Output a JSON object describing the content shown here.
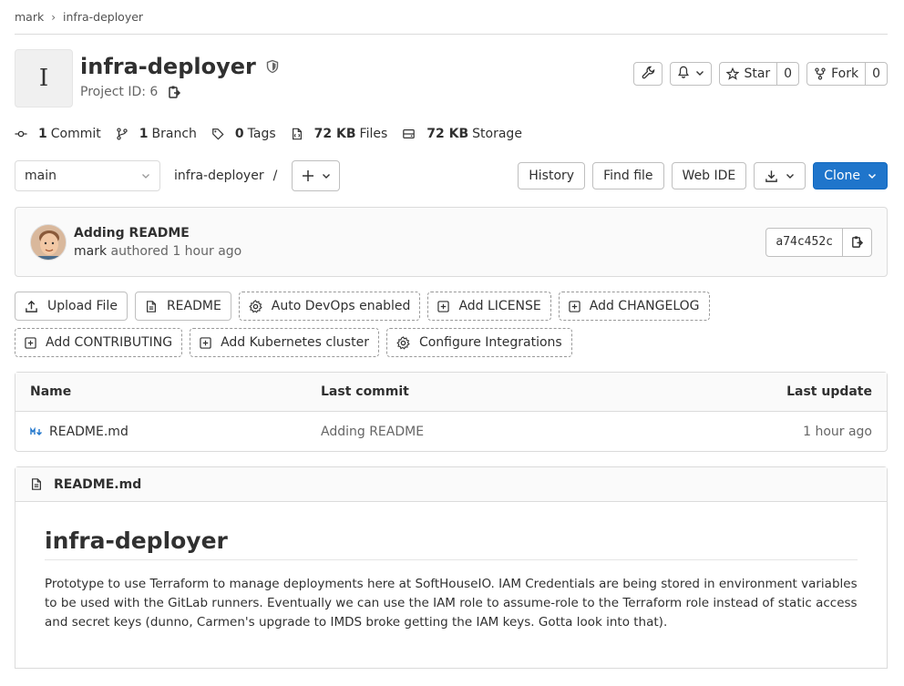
{
  "breadcrumb": {
    "items": [
      "mark",
      "infra-deployer"
    ]
  },
  "project": {
    "avatar_letter": "I",
    "title": "infra-deployer",
    "id_label": "Project ID: 6"
  },
  "actions": {
    "star_label": "Star",
    "star_count": "0",
    "fork_label": "Fork",
    "fork_count": "0"
  },
  "stats": {
    "commits_count": "1",
    "commits_label": "Commit",
    "branches_count": "1",
    "branches_label": "Branch",
    "tags_count": "0",
    "tags_label": "Tags",
    "files_size": "72 KB",
    "files_label": "Files",
    "storage_size": "72 KB",
    "storage_label": "Storage"
  },
  "tree": {
    "branch": "main",
    "path": "infra-deployer",
    "path_sep": "/",
    "history_label": "History",
    "find_file_label": "Find file",
    "web_ide_label": "Web IDE",
    "clone_label": "Clone"
  },
  "commit": {
    "title": "Adding README",
    "author": "mark",
    "meta": "authored 1 hour ago",
    "sha": "a74c452c"
  },
  "quick_actions": [
    "Upload File",
    "README",
    "Auto DevOps enabled",
    "Add LICENSE",
    "Add CHANGELOG",
    "Add CONTRIBUTING",
    "Add Kubernetes cluster",
    "Configure Integrations"
  ],
  "files_table": {
    "headers": {
      "name": "Name",
      "last_commit": "Last commit",
      "last_update": "Last update"
    },
    "rows": [
      {
        "name": "README.md",
        "last_commit": "Adding README",
        "last_update": "1 hour ago"
      }
    ]
  },
  "readme": {
    "file_name": "README.md",
    "heading": "infra-deployer",
    "body": "Prototype to use Terraform to manage deployments here at SoftHouseIO. IAM Credentials are being stored in environment variables to be used with the GitLab runners. Eventually we can use the IAM role to assume-role to the Terraform role instead of static access and secret keys (dunno, Carmen's upgrade to IMDS broke getting the IAM keys. Gotta look into that)."
  },
  "colors": {
    "primary": "#1f75cb",
    "border": "#dbdbdb",
    "muted_text": "#666666"
  },
  "icons": [
    "shield-icon",
    "copy-icon",
    "settings-icon",
    "bell-icon",
    "star-icon",
    "fork-icon",
    "commit-icon",
    "branch-icon",
    "tag-icon",
    "file-icon",
    "storage-icon",
    "plus-icon",
    "download-icon",
    "upload-icon",
    "markdown-icon"
  ]
}
